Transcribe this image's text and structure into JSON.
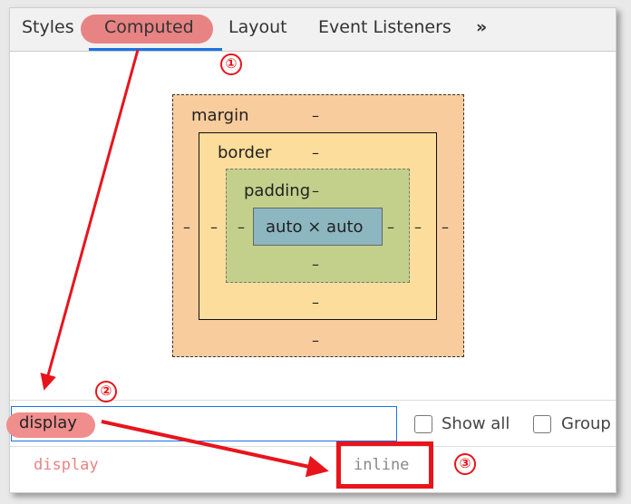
{
  "tabs": [
    {
      "label": "Styles"
    },
    {
      "label": "Computed",
      "active": true
    },
    {
      "label": "Layout"
    },
    {
      "label": "Event Listeners"
    },
    {
      "label": "»"
    }
  ],
  "box_model": {
    "margin": {
      "label": "margin",
      "top": "–",
      "bottom": "–",
      "left": "–",
      "right": "–"
    },
    "border": {
      "label": "border",
      "top": "–",
      "bottom": "–",
      "left": "–",
      "right": "–"
    },
    "padding": {
      "label": "padding",
      "top": "–",
      "bottom": "–",
      "left": "–",
      "right": "–"
    },
    "content": "auto × auto"
  },
  "filter": {
    "value": "display"
  },
  "checkboxes": [
    {
      "label": "Show all",
      "checked": false
    },
    {
      "label": "Group",
      "checked": false
    }
  ],
  "property": {
    "name": "display",
    "value": "inline"
  },
  "annotations": [
    "①",
    "②",
    "③"
  ],
  "colors": {
    "annotation": "#e8141c",
    "highlight": "#e88383",
    "margin": "#f9cc9d",
    "border": "#fddd9b",
    "padding": "#c3d08b",
    "content": "#8cb6c0"
  }
}
